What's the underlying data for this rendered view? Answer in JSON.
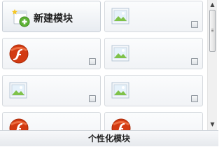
{
  "new_module": {
    "label": "新建模块",
    "icon": "add-module-icon"
  },
  "tiles": [
    {
      "icon": "image-icon",
      "checked": false
    },
    {
      "icon": "flash-icon",
      "checked": false
    },
    {
      "icon": "image-icon",
      "checked": false
    },
    {
      "icon": "image-icon",
      "checked": false
    },
    {
      "icon": "image-icon",
      "checked": false
    },
    {
      "icon": "flash-icon",
      "checked": false
    },
    {
      "icon": "flash-icon",
      "checked": false
    }
  ],
  "footer": {
    "title": "个性化模块"
  },
  "colors": {
    "flash_red": "#d23a12",
    "image_frame": "#b8c7d6",
    "image_green": "#7fc24a"
  }
}
